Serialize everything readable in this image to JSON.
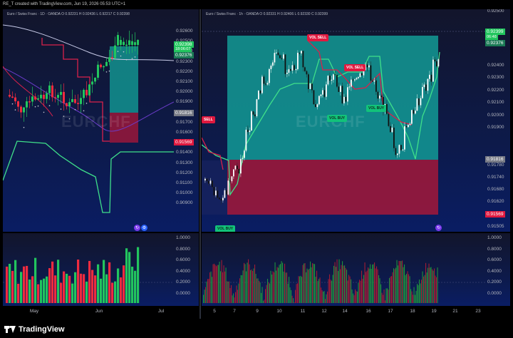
{
  "header": {
    "text": "RE_T created with TradingView.com, Jun 19, 2026 05:53 UTC+1"
  },
  "footer": {
    "brand": "TradingView"
  },
  "colors": {
    "bull": "#22c55e",
    "bear": "#ef2b3f",
    "teal_zone": "#13a39b",
    "red_zone": "#a3173a",
    "trail": "#3fe08a",
    "accent": "#e0193f"
  },
  "left_chart": {
    "title": "Euro / Swiss Franc · 1D · OANDA  O 0.92231  H 0.92436  L 0.92217  C 0.92398",
    "watermark": "EURCHF",
    "y_labels": [
      "0.92600",
      "0.92500",
      "0.92400",
      "0.92300",
      "0.92200",
      "0.92100",
      "0.92000",
      "0.91900",
      "0.91800",
      "0.91700",
      "0.91600",
      "0.91500",
      "0.91400",
      "0.91300",
      "0.91200",
      "0.91100",
      "0.91000",
      "0.90900"
    ],
    "tags": {
      "current": "0.92398",
      "countdown": "18:06:07",
      "level_high": "0.92376",
      "level_mid": "0.91816",
      "level_low": "0.91569"
    },
    "x_labels": [
      "May",
      "Jun",
      "Jul"
    ],
    "osc_labels": [
      "1.0000",
      "0.8000",
      "0.6000",
      "0.4000",
      "0.2000",
      "0.0000"
    ]
  },
  "right_chart": {
    "title": "Euro / Swiss Franc · 1h · OANDA  O 0.92331  H 0.92406  L 0.92330  C 0.92399",
    "watermark": "EURCHF",
    "y_labels": [
      "0.92500",
      "0.92400",
      "0.92300",
      "0.92200",
      "0.92100",
      "0.92000",
      "0.91900",
      "0.91780",
      "0.91740",
      "0.91680",
      "0.91620",
      "0.91560",
      "0.91505"
    ],
    "top_label": "0.92500",
    "tags": {
      "current": "0.92399",
      "countdown": "06:48",
      "level_high": "0.92376",
      "level_mid": "0.91816",
      "level_low": "0.91569"
    },
    "x_labels": [
      "5",
      "7",
      "9",
      "10",
      "11",
      "12",
      "14",
      "16",
      "17",
      "18",
      "19",
      "21",
      "23"
    ],
    "osc_labels": [
      "1.0000",
      "0.8000",
      "0.6000",
      "0.4000",
      "0.2000",
      "0.0000"
    ],
    "signals": [
      "VOL SELL",
      "VOL SELL",
      "VOL BUY",
      "VOL BUY",
      "VOL BUY",
      "SELL"
    ]
  }
}
